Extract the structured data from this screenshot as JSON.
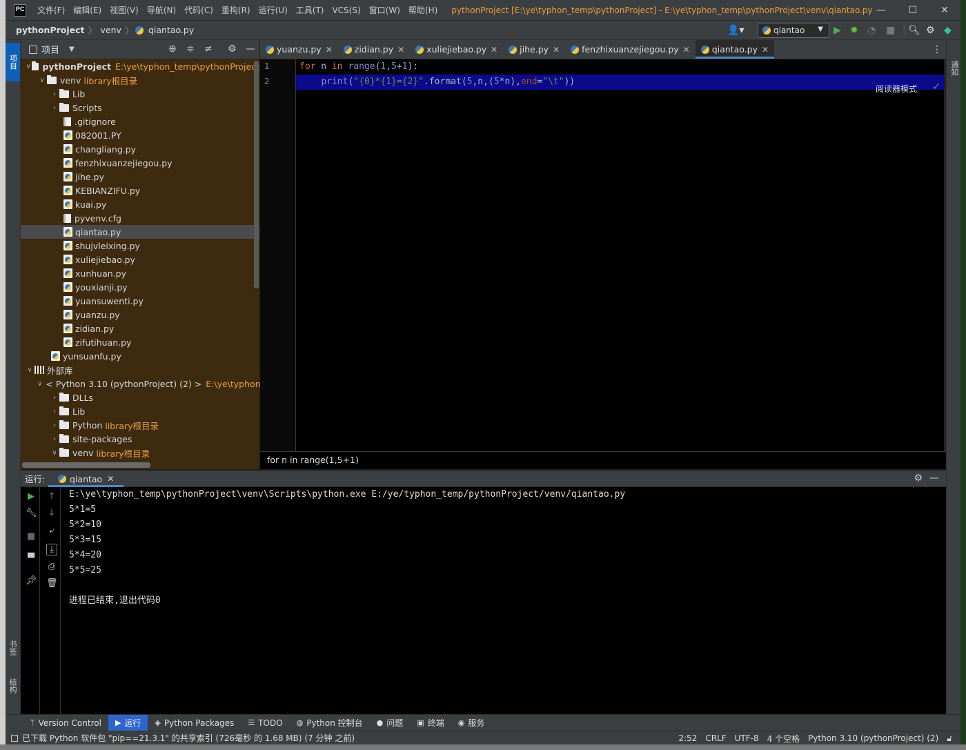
{
  "titlebar": {
    "logo": "PC",
    "menu": [
      "文件(F)",
      "编辑(E)",
      "视图(V)",
      "导航(N)",
      "代码(C)",
      "重构(R)",
      "运行(U)",
      "工具(T)",
      "VCS(S)",
      "窗口(W)",
      "帮助(H)"
    ],
    "title": "pythonProject [E:\\ye\\typhon_temp\\pythonProject] - E:\\ye\\typhon_temp\\pythonProject\\venv\\qiantao.py",
    "minimize": "—",
    "maximize": "☐",
    "close": "✕"
  },
  "navbar": {
    "crumbs": [
      "pythonProject",
      "venv",
      "qiantao.py"
    ],
    "run_config": "qiantao"
  },
  "leftstrip": {
    "project": "项目",
    "bookmarks": "书签",
    "structure": "结构"
  },
  "rightstrip": {
    "notifications": "通知"
  },
  "project_panel": {
    "title": "项目",
    "tree": [
      {
        "label": "pythonProject",
        "path": "E:\\ye\\typhon_temp\\pythonProject"
      },
      {
        "label": "venv",
        "lib": "library根目录"
      },
      {
        "label": "Lib"
      },
      {
        "label": "Scripts"
      },
      {
        "label": ".gitignore"
      },
      {
        "label": "082001.PY"
      },
      {
        "label": "changliang.py"
      },
      {
        "label": "fenzhixuanzejiegou.py"
      },
      {
        "label": "jihe.py"
      },
      {
        "label": "KEBIANZIFU.py"
      },
      {
        "label": "kuai.py"
      },
      {
        "label": "pyvenv.cfg"
      },
      {
        "label": "qiantao.py"
      },
      {
        "label": "shujvleixing.py"
      },
      {
        "label": "xuliejiebao.py"
      },
      {
        "label": "xunhuan.py"
      },
      {
        "label": "youxianji.py"
      },
      {
        "label": "yuansuwenti.py"
      },
      {
        "label": "yuanzu.py"
      },
      {
        "label": "zidian.py"
      },
      {
        "label": "zifutihuan.py"
      },
      {
        "label": "yunsuanfu.py"
      },
      {
        "label": "外部库"
      },
      {
        "label": "< Python 3.10 (pythonProject) (2) >",
        "path": "E:\\ye\\typhon"
      },
      {
        "label": "DLLs"
      },
      {
        "label": "Lib"
      },
      {
        "label": "Python",
        "lib": "library根目录"
      },
      {
        "label": "site-packages"
      },
      {
        "label": "venv",
        "lib": "library根目录"
      }
    ]
  },
  "editor": {
    "tabs": [
      "yuanzu.py",
      "zidian.py",
      "xuliejiebao.py",
      "jihe.py",
      "fenzhixuanzejiegou.py",
      "qiantao.py"
    ],
    "active_tab": "qiantao.py",
    "line_numbers": [
      "1",
      "2"
    ],
    "reader_mode": "阅读器模式",
    "breadcrumb": "for n in range(1,5+1)"
  },
  "run_panel": {
    "label": "运行:",
    "tab": "qiantao",
    "output": [
      "E:\\ye\\typhon_temp\\pythonProject\\venv\\Scripts\\python.exe E:/ye/typhon_temp/pythonProject/venv/qiantao.py",
      "5*1=5",
      "5*2=10",
      "5*3=15",
      "5*4=20",
      "5*5=25",
      "",
      "进程已结束,退出代码0"
    ]
  },
  "bottom_tabs": [
    "Version Control",
    "运行",
    "Python Packages",
    "TODO",
    "Python 控制台",
    "问题",
    "终端",
    "服务"
  ],
  "statusbar": {
    "message": "已下载 Python 软件包 \"pip==21.3.1\" 的共享索引 (726毫秒 的 1.68 MB) (7 分钟 之前)",
    "position": "2:52",
    "line_sep": "CRLF",
    "encoding": "UTF-8",
    "indent": "4 个空格",
    "interpreter": "Python 3.10 (pythonProject) (2)"
  },
  "colors": {
    "accent": "#4a88c7",
    "run_active": "#2f65ca",
    "project_bg": "#3d2a0f",
    "lib_text": "#e8a03c"
  }
}
